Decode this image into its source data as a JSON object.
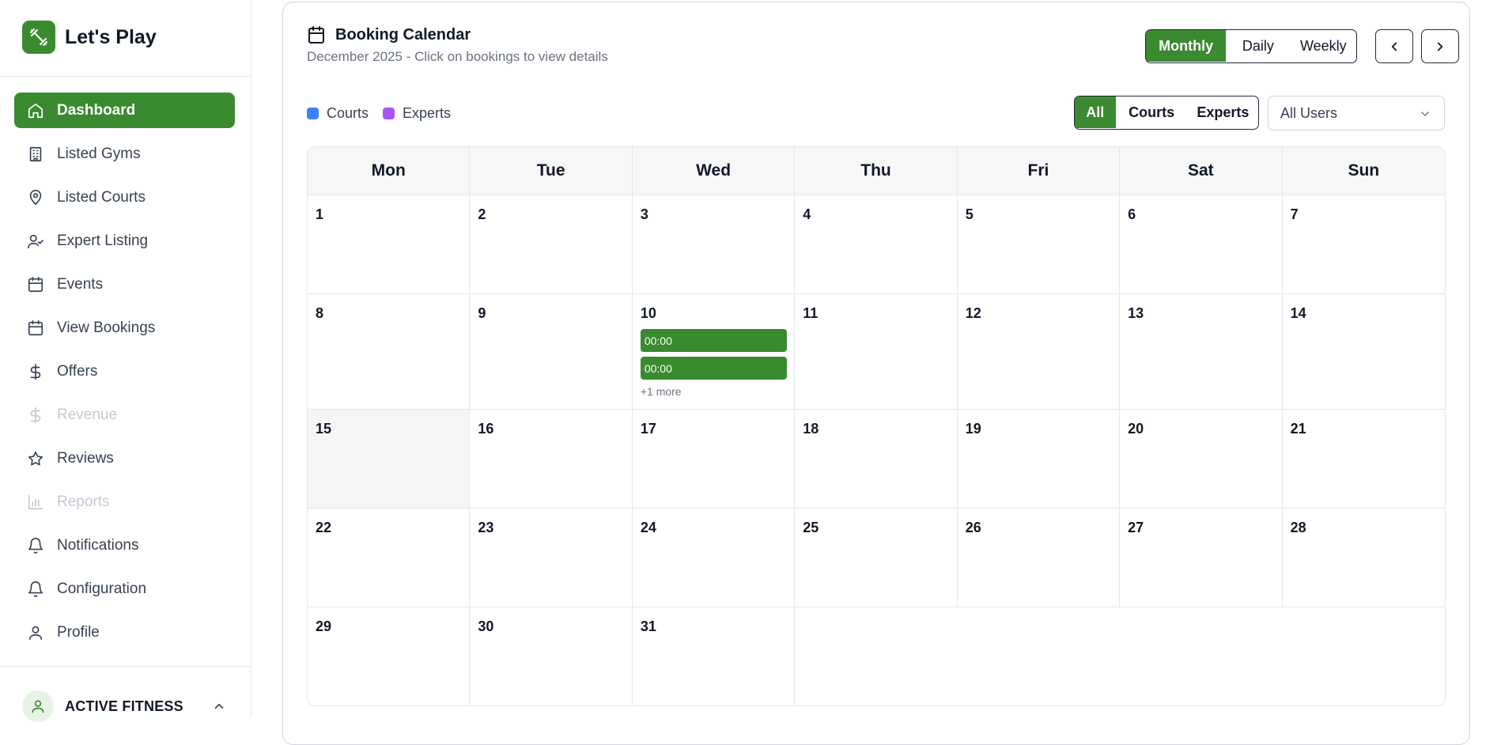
{
  "brand": {
    "name": "Let's Play"
  },
  "sidebar": {
    "items": [
      {
        "label": "Dashboard",
        "icon": "home-icon",
        "state": "active"
      },
      {
        "label": "Listed Gyms",
        "icon": "building-icon",
        "state": "normal"
      },
      {
        "label": "Listed Courts",
        "icon": "map-pin-icon",
        "state": "normal"
      },
      {
        "label": "Expert Listing",
        "icon": "user-check-icon",
        "state": "normal"
      },
      {
        "label": "Events",
        "icon": "calendar-icon",
        "state": "normal"
      },
      {
        "label": "View Bookings",
        "icon": "calendar-icon",
        "state": "normal"
      },
      {
        "label": "Offers",
        "icon": "dollar-icon",
        "state": "normal"
      },
      {
        "label": "Revenue",
        "icon": "dollar-icon",
        "state": "disabled"
      },
      {
        "label": "Reviews",
        "icon": "star-icon",
        "state": "normal"
      },
      {
        "label": "Reports",
        "icon": "bar-chart-icon",
        "state": "disabled"
      },
      {
        "label": "Notifications",
        "icon": "bell-icon",
        "state": "normal"
      },
      {
        "label": "Configuration",
        "icon": "bell-icon",
        "state": "normal"
      },
      {
        "label": "Profile",
        "icon": "user-icon",
        "state": "normal"
      }
    ],
    "account_name": "ACTIVE FITNESS"
  },
  "calendar": {
    "title": "Booking Calendar",
    "subtitle": "December 2025 - Click on bookings to view details",
    "view_tabs": [
      {
        "label": "Monthly",
        "active": true
      },
      {
        "label": "Daily",
        "active": false
      },
      {
        "label": "Weekly",
        "active": false
      }
    ],
    "legend": [
      {
        "label": "Courts",
        "color": "#3b82f6"
      },
      {
        "label": "Experts",
        "color": "#a855f7"
      }
    ],
    "filter_tabs": [
      {
        "label": "All",
        "active": true
      },
      {
        "label": "Courts",
        "active": false
      },
      {
        "label": "Experts",
        "active": false
      }
    ],
    "user_filter": "All Users",
    "weekdays": [
      "Mon",
      "Tue",
      "Wed",
      "Thu",
      "Fri",
      "Sat",
      "Sun"
    ],
    "weeks": [
      [
        {
          "day": "1"
        },
        {
          "day": "2"
        },
        {
          "day": "3"
        },
        {
          "day": "4"
        },
        {
          "day": "5"
        },
        {
          "day": "6"
        },
        {
          "day": "7"
        }
      ],
      [
        {
          "day": "8"
        },
        {
          "day": "9"
        },
        {
          "day": "10",
          "events": [
            "00:00",
            "00:00"
          ],
          "more": "+1 more"
        },
        {
          "day": "11"
        },
        {
          "day": "12"
        },
        {
          "day": "13"
        },
        {
          "day": "14"
        }
      ],
      [
        {
          "day": "15",
          "today": true
        },
        {
          "day": "16"
        },
        {
          "day": "17"
        },
        {
          "day": "18"
        },
        {
          "day": "19"
        },
        {
          "day": "20"
        },
        {
          "day": "21"
        }
      ],
      [
        {
          "day": "22"
        },
        {
          "day": "23"
        },
        {
          "day": "24"
        },
        {
          "day": "25"
        },
        {
          "day": "26"
        },
        {
          "day": "27"
        },
        {
          "day": "28"
        }
      ],
      [
        {
          "day": "29"
        },
        {
          "day": "30"
        },
        {
          "day": "31"
        },
        {
          "day": ""
        },
        {
          "day": ""
        },
        {
          "day": ""
        },
        {
          "day": ""
        }
      ]
    ],
    "accent": "#3a8a2f"
  }
}
